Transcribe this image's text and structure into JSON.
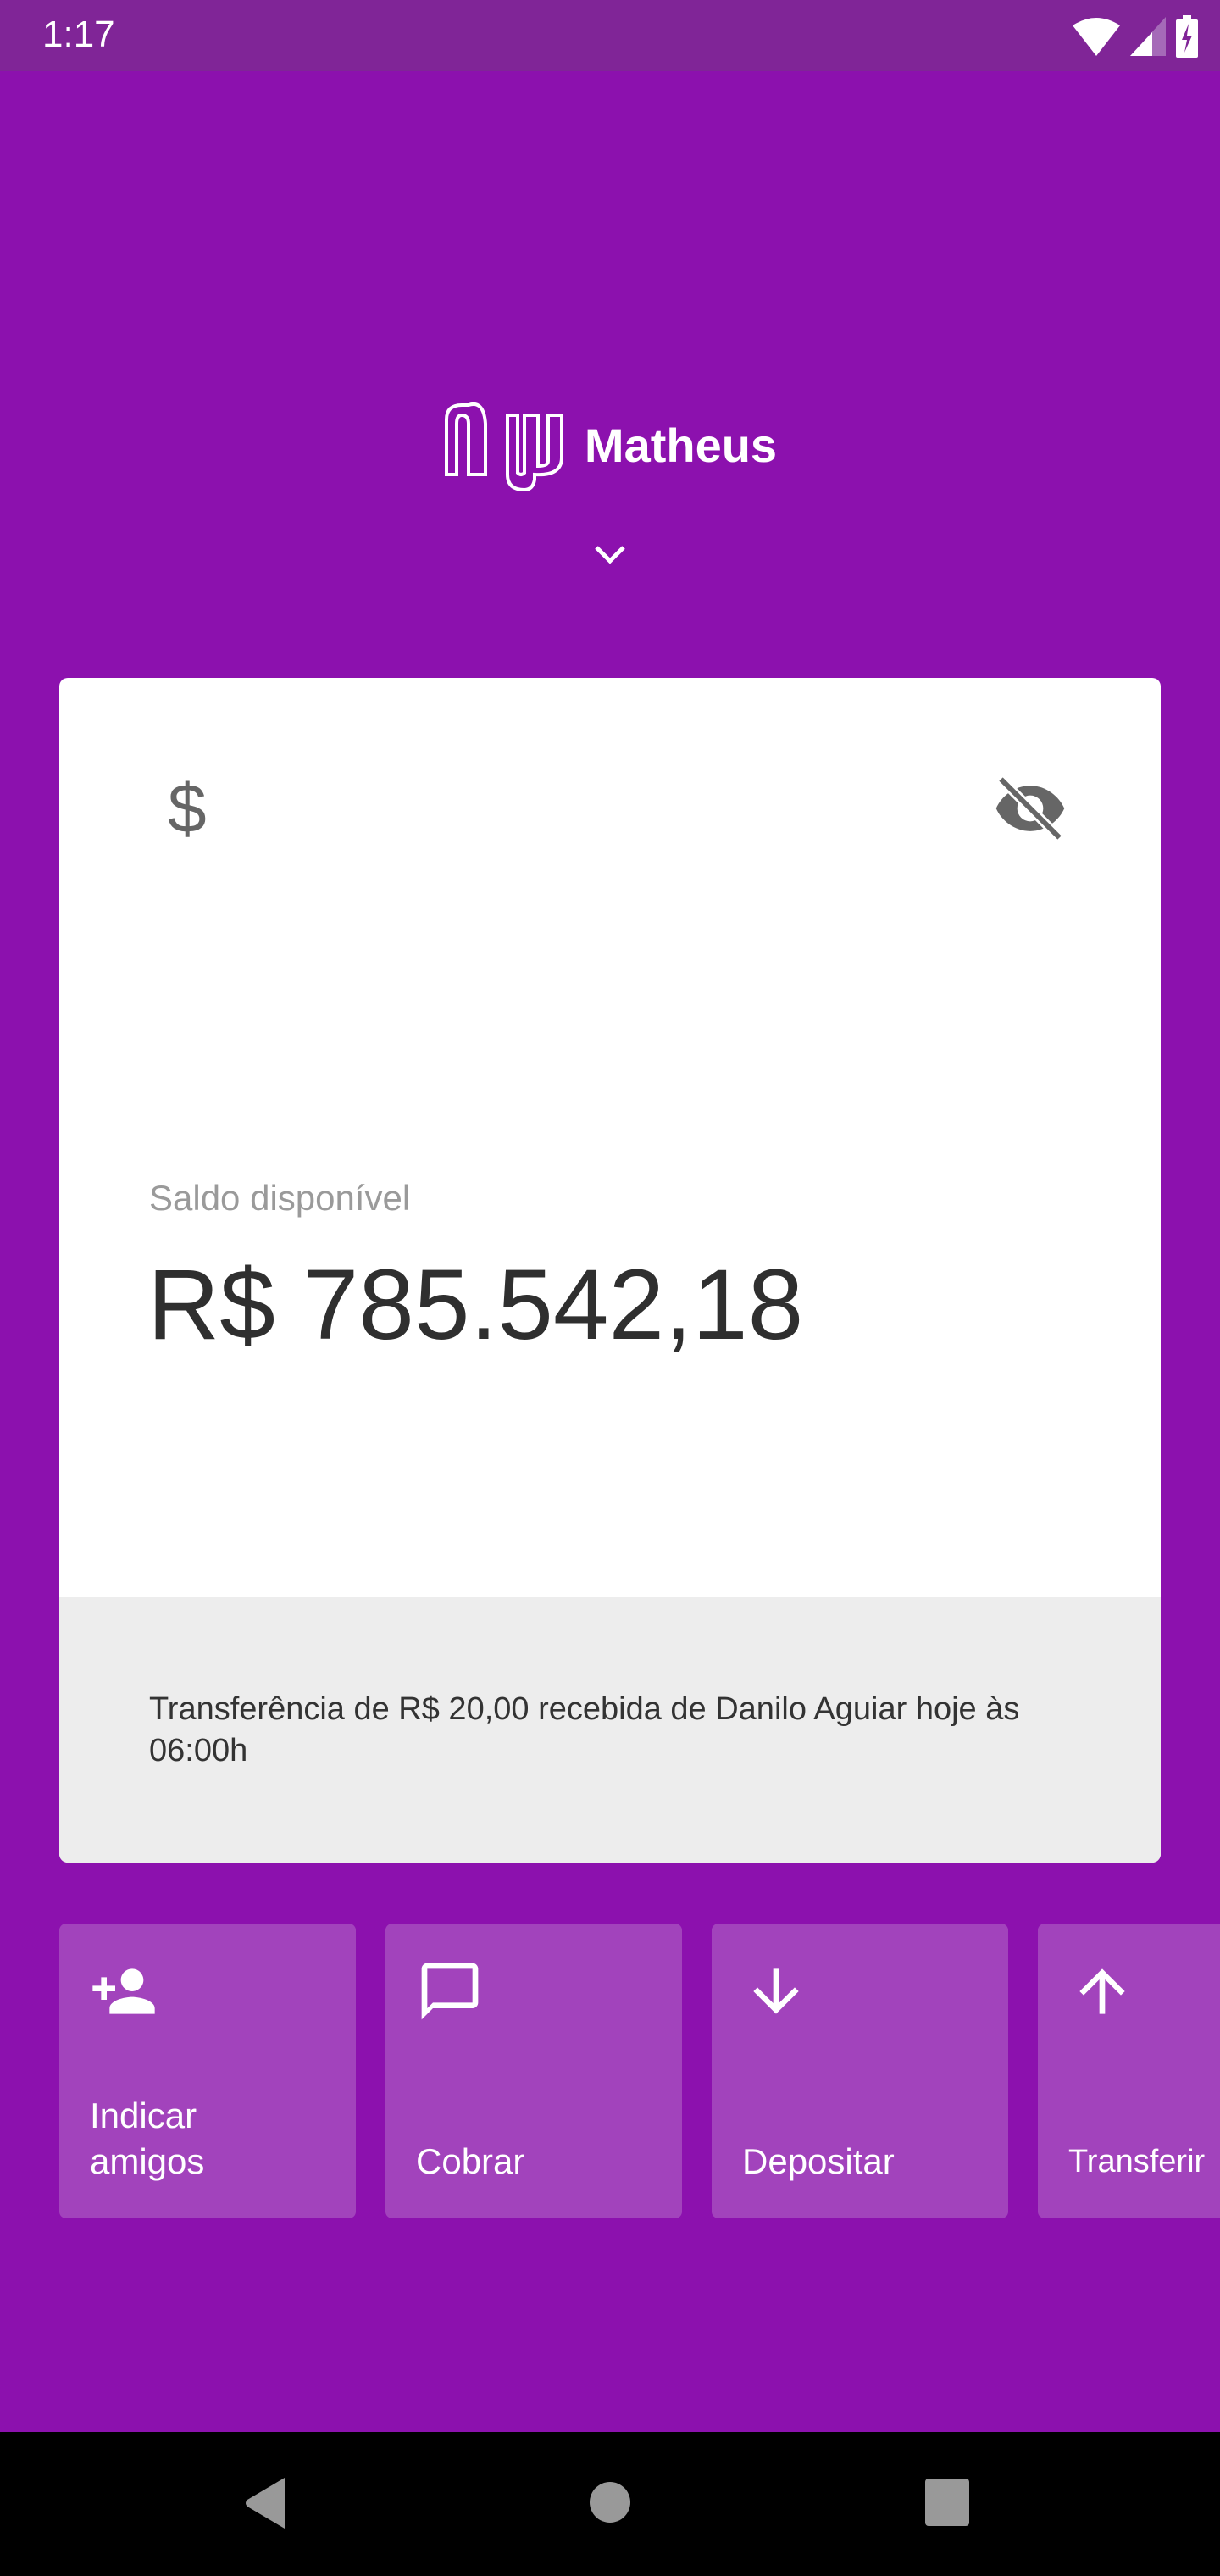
{
  "status_bar": {
    "time": "1:17",
    "icons": [
      "wifi-icon",
      "signal-icon",
      "battery-charging-icon"
    ]
  },
  "header": {
    "logo": "nu",
    "user_name": "Matheus",
    "expand_icon": "chevron-down-icon"
  },
  "balance_card": {
    "icons": [
      "dollar-icon",
      "eye-off-icon"
    ],
    "label": "Saldo disponível",
    "amount": "R$ 785.542,18",
    "notice": "Transferência de R$ 20,00 recebida de Danilo Aguiar hoje às 06:00h"
  },
  "actions": [
    {
      "label": "Indicar amigos",
      "icon": "person-add-icon"
    },
    {
      "label": "Cobrar",
      "icon": "chat-bubble-icon"
    },
    {
      "label": "Depositar",
      "icon": "arrow-down-icon"
    },
    {
      "label": "Transferir",
      "icon": "arrow-up-icon"
    }
  ],
  "colors": {
    "background": "#8c11ae",
    "status_bar": "#802597",
    "tile": "#a243bc",
    "card": "#ffffff",
    "notice": "#ededed"
  }
}
